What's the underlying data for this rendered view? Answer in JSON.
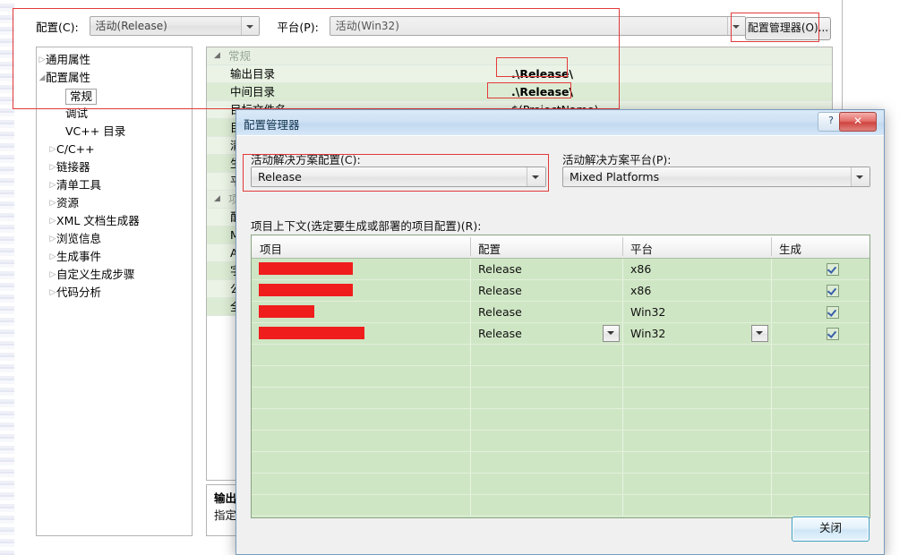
{
  "background": {
    "config_label": "配置(C):",
    "config_value": "活动(Release)",
    "platform_label": "平台(P):",
    "platform_value": "活动(Win32)",
    "config_manager_button": "配置管理器(O)...",
    "tree": [
      {
        "label": "通用属性",
        "arrow": "collapsed",
        "indent": 10,
        "selected": false
      },
      {
        "label": "配置属性",
        "arrow": "expanded",
        "indent": 10,
        "selected": false
      },
      {
        "label": "常规",
        "arrow": "none",
        "indent": 32,
        "selected": true
      },
      {
        "label": "调试",
        "arrow": "none",
        "indent": 32,
        "selected": false
      },
      {
        "label": "VC++ 目录",
        "arrow": "none",
        "indent": 32,
        "selected": false
      },
      {
        "label": "C/C++",
        "arrow": "collapsed",
        "indent": 22,
        "selected": false
      },
      {
        "label": "链接器",
        "arrow": "collapsed",
        "indent": 22,
        "selected": false
      },
      {
        "label": "清单工具",
        "arrow": "collapsed",
        "indent": 22,
        "selected": false
      },
      {
        "label": "资源",
        "arrow": "collapsed",
        "indent": 22,
        "selected": false
      },
      {
        "label": "XML 文档生成器",
        "arrow": "collapsed",
        "indent": 22,
        "selected": false
      },
      {
        "label": "浏览信息",
        "arrow": "collapsed",
        "indent": 22,
        "selected": false
      },
      {
        "label": "生成事件",
        "arrow": "collapsed",
        "indent": 22,
        "selected": false
      },
      {
        "label": "自定义生成步骤",
        "arrow": "collapsed",
        "indent": 22,
        "selected": false
      },
      {
        "label": "代码分析",
        "arrow": "collapsed",
        "indent": 22,
        "selected": false
      }
    ],
    "grid_rows": [
      {
        "name": "常规",
        "value": "",
        "category": true
      },
      {
        "name": "输出目录",
        "value": ".\\Release\\",
        "category": false
      },
      {
        "name": "中间目录",
        "value": ".\\Release\\",
        "category": false
      },
      {
        "name": "目标文件名",
        "value": "$(ProjectName)",
        "category": false
      },
      {
        "name": "目标文件扩展名",
        "value": "",
        "category": false
      },
      {
        "name": "清除时删除的扩展名",
        "value": "",
        "category": false
      },
      {
        "name": "生成日志文件",
        "value": "",
        "category": false
      },
      {
        "name": "平台工具集",
        "value": "",
        "category": false
      },
      {
        "name": "项目默认值",
        "value": "",
        "category": true
      },
      {
        "name": "配置类型",
        "value": "",
        "category": false
      },
      {
        "name": "MFC 的使用",
        "value": "",
        "category": false
      },
      {
        "name": "ATL 的使用",
        "value": "",
        "category": false
      },
      {
        "name": "字符集",
        "value": "",
        "category": false
      },
      {
        "name": "公共语言运行时支持",
        "value": "",
        "category": false
      },
      {
        "name": "全程序优化",
        "value": "",
        "category": false
      }
    ],
    "description": {
      "title": "输出目录",
      "body": "指定输出..."
    }
  },
  "dialog": {
    "title": "配置管理器",
    "help_icon": "?",
    "close_icon": "✕",
    "active_solution_config_label": "活动解决方案配置(C):",
    "active_solution_config_value": "Release",
    "active_solution_platform_label": "活动解决方案平台(P):",
    "active_solution_platform_value": "Mixed Platforms",
    "project_context_label": "项目上下文(选定要生成或部署的项目配置)(R):",
    "table": {
      "headers": [
        "项目",
        "配置",
        "平台",
        "生成"
      ],
      "rows": [
        {
          "project": "",
          "redact_width": 105,
          "config": "Release",
          "platform": "x86",
          "build": true,
          "config_dropdown": false,
          "platform_dropdown": false
        },
        {
          "project": "",
          "redact_width": 105,
          "config": "Release",
          "platform": "x86",
          "build": true,
          "config_dropdown": false,
          "platform_dropdown": false
        },
        {
          "project": "",
          "redact_width": 62,
          "config": "Release",
          "platform": "Win32",
          "build": true,
          "config_dropdown": false,
          "platform_dropdown": false
        },
        {
          "project": "",
          "redact_width": 118,
          "config": "Release",
          "platform": "Win32",
          "build": true,
          "config_dropdown": true,
          "platform_dropdown": true
        }
      ]
    },
    "close_button": "关闭"
  },
  "annotation_color": "#e23a3a"
}
